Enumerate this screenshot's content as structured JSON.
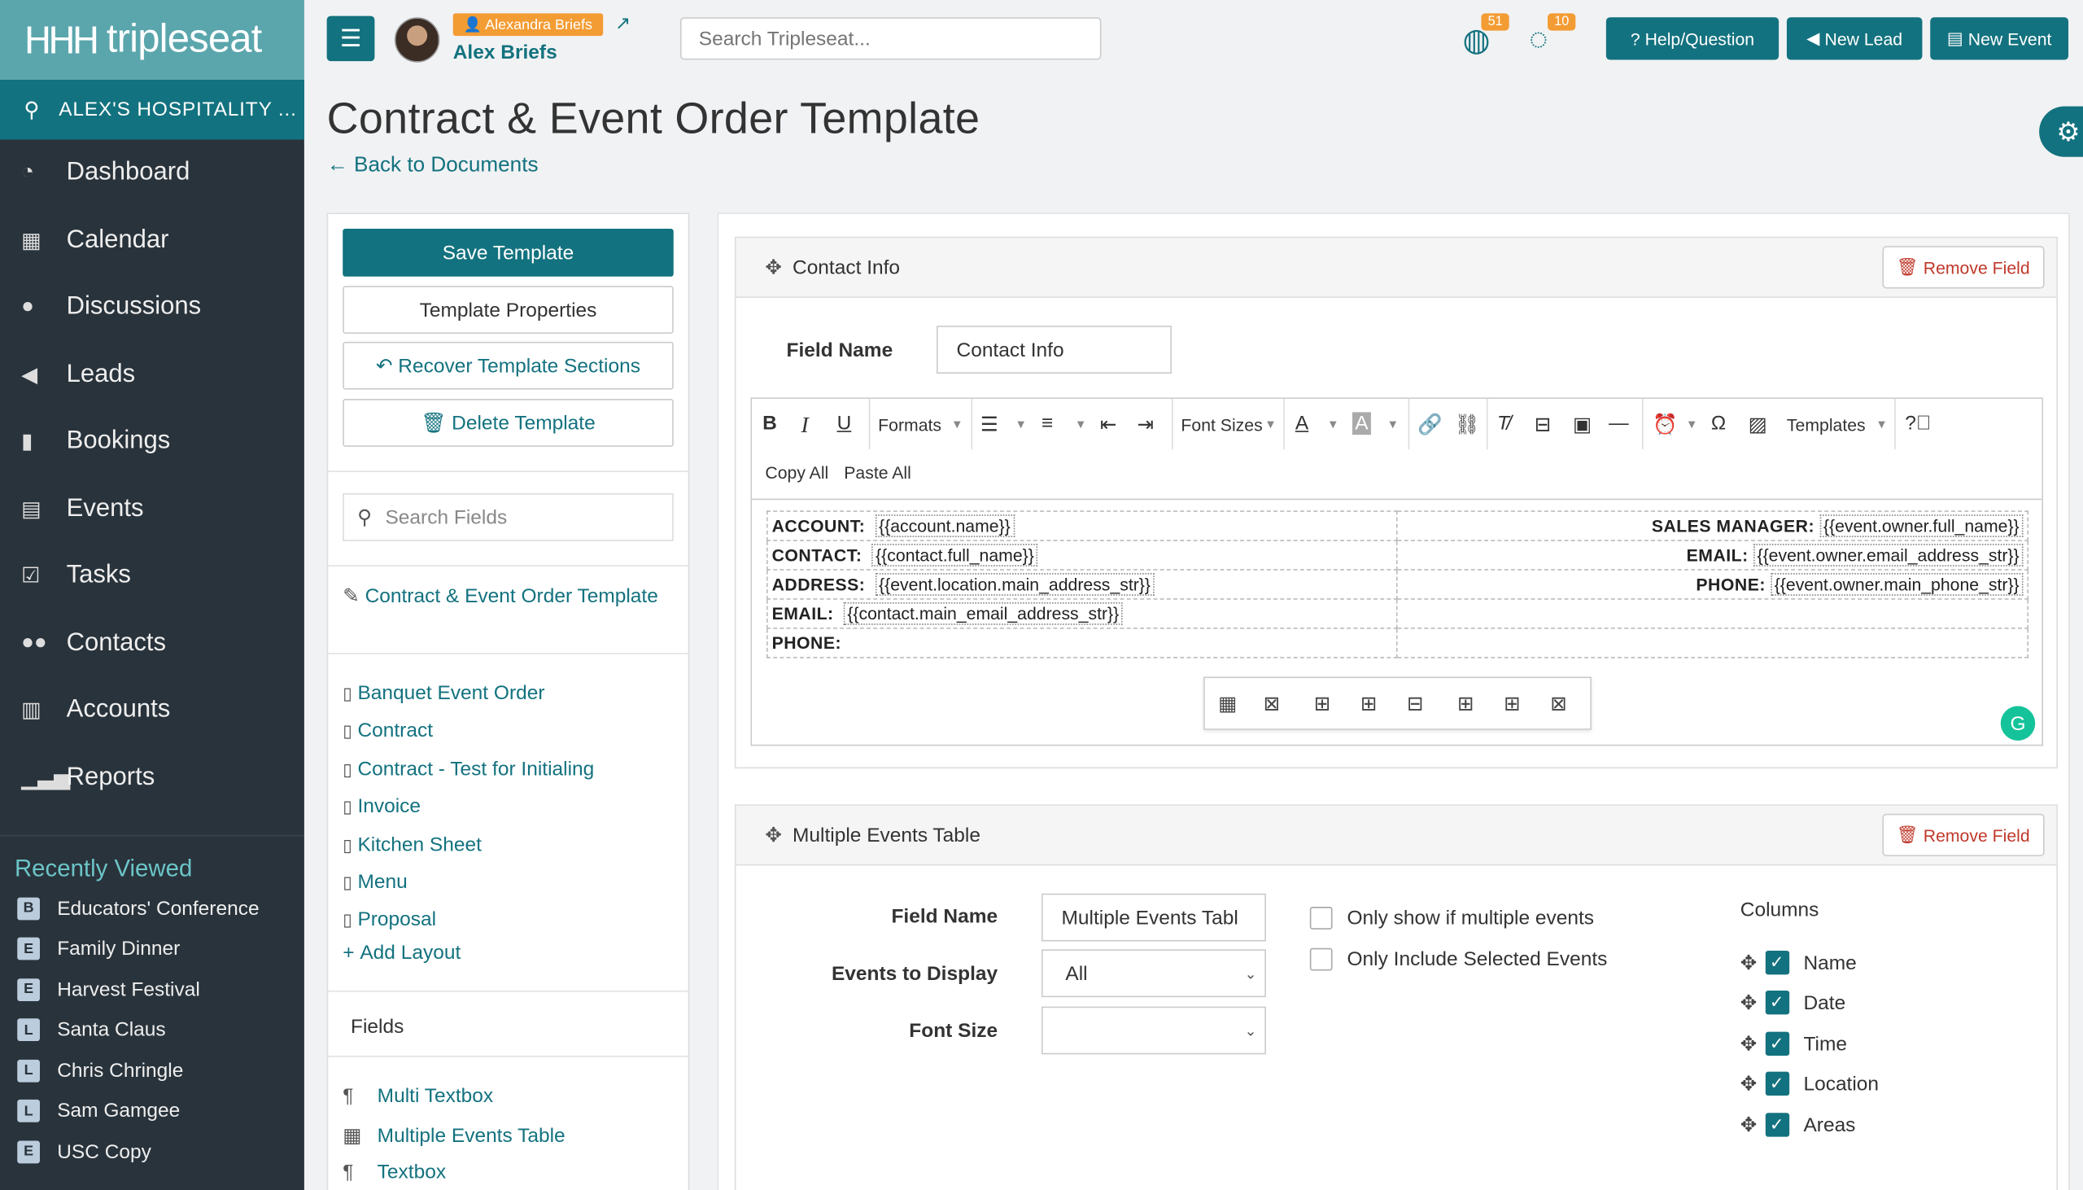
{
  "app": {
    "name": "tripleseat",
    "venue": "ALEX'S HOSPITALITY ..."
  },
  "nav": [
    {
      "label": "Dashboard",
      "icon": "dashboard-icon"
    },
    {
      "label": "Calendar",
      "icon": "calendar-icon"
    },
    {
      "label": "Discussions",
      "icon": "chat-icon"
    },
    {
      "label": "Leads",
      "icon": "megaphone-icon"
    },
    {
      "label": "Bookings",
      "icon": "bookmark-icon"
    },
    {
      "label": "Events",
      "icon": "list-icon"
    },
    {
      "label": "Tasks",
      "icon": "checkbox-icon"
    },
    {
      "label": "Contacts",
      "icon": "users-icon"
    },
    {
      "label": "Accounts",
      "icon": "building-icon"
    },
    {
      "label": "Reports",
      "icon": "bar-chart-icon"
    }
  ],
  "recent": {
    "title": "Recently Viewed",
    "items": [
      {
        "badge": "B",
        "label": "Educators' Conference"
      },
      {
        "badge": "E",
        "label": "Family Dinner"
      },
      {
        "badge": "E",
        "label": "Harvest Festival"
      },
      {
        "badge": "L",
        "label": "Santa Claus"
      },
      {
        "badge": "L",
        "label": "Chris Chringle"
      },
      {
        "badge": "L",
        "label": "Sam Gamgee"
      },
      {
        "badge": "E",
        "label": "USC Copy"
      }
    ]
  },
  "topbar": {
    "user_badge": "Alexandra Briefs",
    "user_name": "Alex Briefs",
    "search_placeholder": "Search Tripleseat...",
    "globe_count": "51",
    "chat_count": "10",
    "help_label": "Help/Question",
    "new_lead_label": "New Lead",
    "new_event_label": "New Event"
  },
  "page": {
    "title": "Contract & Event Order Template",
    "back_link": "Back to Documents"
  },
  "left": {
    "save": "Save Template",
    "properties": "Template Properties",
    "recover": "Recover Template Sections",
    "delete": "Delete Template",
    "search_placeholder": "Search Fields",
    "current_template": "Contract & Event Order Template",
    "layouts": [
      "Banquet Event Order",
      "Contract",
      "Contract - Test for Initialing",
      "Invoice",
      "Kitchen Sheet",
      "Menu",
      "Proposal"
    ],
    "add_layout": "Add Layout",
    "fields_title": "Fields",
    "fields": [
      {
        "label": "Multi Textbox",
        "icon": "paragraph-icon"
      },
      {
        "label": "Multiple Events Table",
        "icon": "table-icon"
      },
      {
        "label": "Textbox",
        "icon": "paragraph-icon"
      }
    ]
  },
  "contact_section": {
    "title": "Contact Info",
    "remove": "Remove Field",
    "field_name_label": "Field Name",
    "field_name_value": "Contact Info",
    "toolbar": {
      "formats": "Formats",
      "font_sizes": "Font Sizes",
      "templates": "Templates",
      "copy_all": "Copy All",
      "paste_all": "Paste All"
    },
    "rows": [
      {
        "l_label": "ACCOUNT:",
        "l_token": "{{account.name}}",
        "r_label": "SALES MANAGER:",
        "r_token": "{{event.owner.full_name}}"
      },
      {
        "l_label": "CONTACT:",
        "l_token": "{{contact.full_name}}",
        "r_label": "EMAIL:",
        "r_token": "{{event.owner.email_address_str}}"
      },
      {
        "l_label": "ADDRESS:",
        "l_token": "{{event.location.main_address_str}}",
        "r_label": "PHONE:",
        "r_token": "{{event.owner.main_phone_str}}"
      },
      {
        "l_label": "EMAIL:",
        "l_token": "{{contact.main_email_address_str}}",
        "r_label": "",
        "r_token": ""
      },
      {
        "l_label": "PHONE:",
        "l_token": "",
        "r_label": "",
        "r_token": ""
      }
    ]
  },
  "multi_section": {
    "title": "Multiple Events Table",
    "remove": "Remove Field",
    "field_name_label": "Field Name",
    "field_name_value": "Multiple Events Tabl",
    "events_label": "Events to Display",
    "events_value": "All",
    "font_size_label": "Font Size",
    "font_size_value": "",
    "only_multiple": "Only show if multiple events",
    "only_selected": "Only Include Selected Events",
    "columns_title": "Columns",
    "columns": [
      "Name",
      "Date",
      "Time",
      "Location",
      "Areas"
    ]
  }
}
